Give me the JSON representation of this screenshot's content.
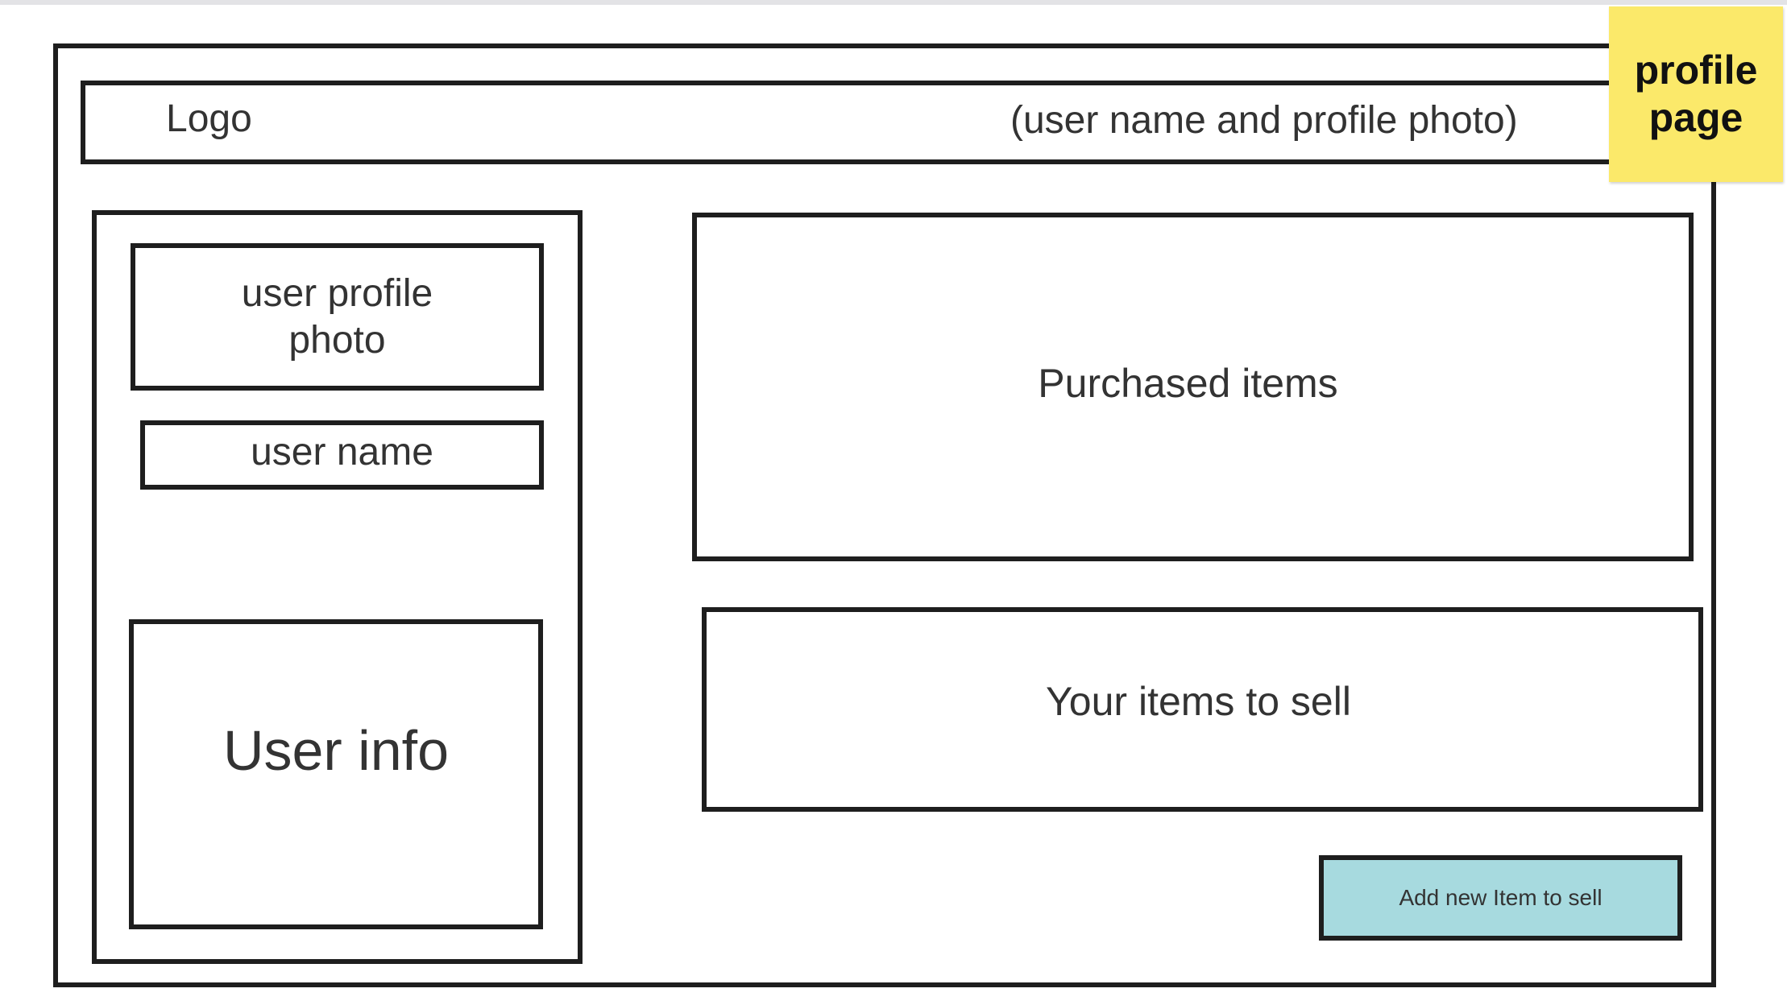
{
  "header": {
    "logo": "Logo",
    "user_area": "(user name and profile photo)"
  },
  "sticky_note": {
    "label": "profile\npage",
    "color": "#fbe96a"
  },
  "sidebar": {
    "profile_photo": "user profile\nphoto",
    "user_name": "user name",
    "user_info": "User info"
  },
  "main": {
    "purchased_items": "Purchased items",
    "items_to_sell": "Your items to sell",
    "add_item_button": "Add new Item to sell",
    "add_item_button_color": "#a7dadf"
  }
}
